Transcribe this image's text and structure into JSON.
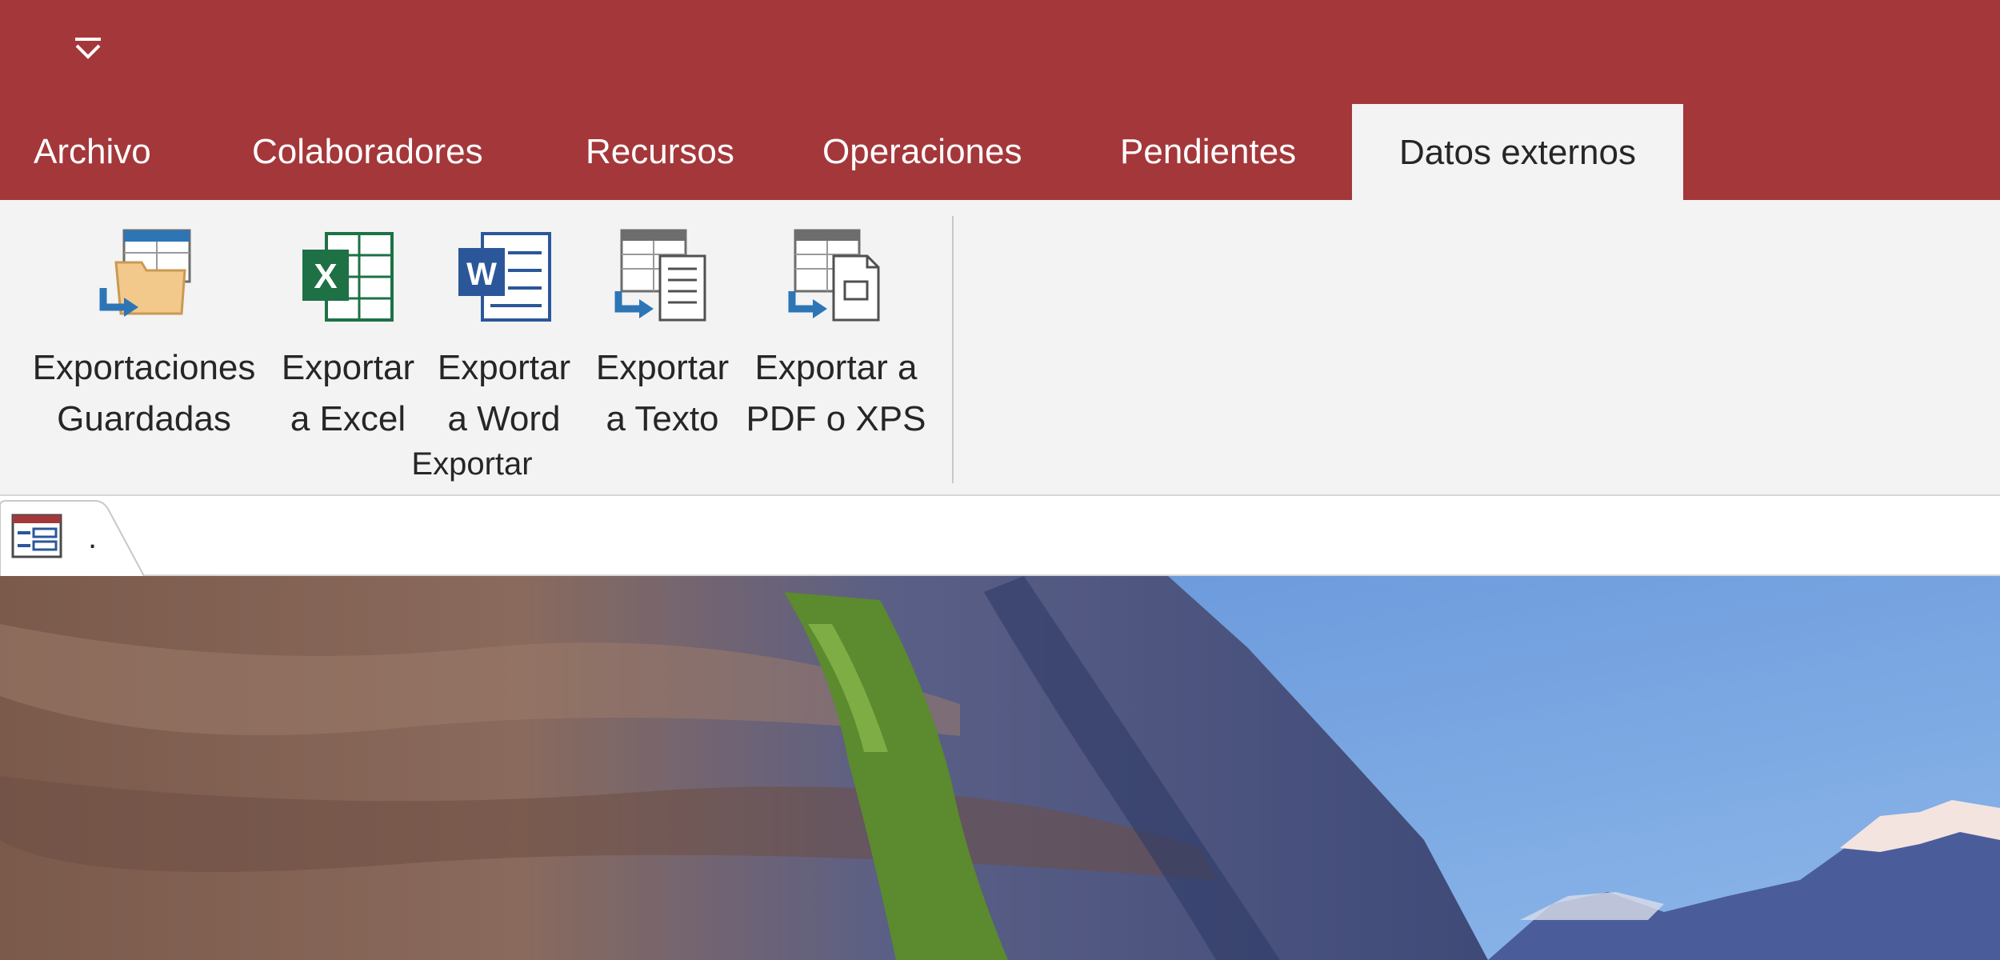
{
  "qat": {
    "icon": "customize-quick-access-icon"
  },
  "tabs": [
    {
      "label": "Archivo"
    },
    {
      "label": "Colaboradores"
    },
    {
      "label": "Recursos"
    },
    {
      "label": "Operaciones"
    },
    {
      "label": "Pendientes"
    },
    {
      "label": "Datos externos",
      "active": true
    }
  ],
  "ribbon": {
    "group_label": "Exportar",
    "buttons": [
      {
        "line1": "Exportaciones",
        "line2": "Guardadas",
        "icon": "saved-exports-icon"
      },
      {
        "line1": "Exportar",
        "line2": "a Excel",
        "icon": "excel-icon"
      },
      {
        "line1": "Exportar",
        "line2": "a Word",
        "icon": "word-icon"
      },
      {
        "line1": "Exportar",
        "line2": "a Texto",
        "icon": "text-file-icon"
      },
      {
        "line1": "Exportar a",
        "line2": "PDF o XPS",
        "icon": "pdf-xps-icon"
      }
    ]
  },
  "document_tab": {
    "label": ".",
    "icon": "form-icon"
  },
  "colors": {
    "accent": "#a4373a",
    "ribbon_bg": "#f3f3f3",
    "excel": "#1e7145",
    "word": "#2b579a",
    "export_arrow": "#2e75b6"
  }
}
